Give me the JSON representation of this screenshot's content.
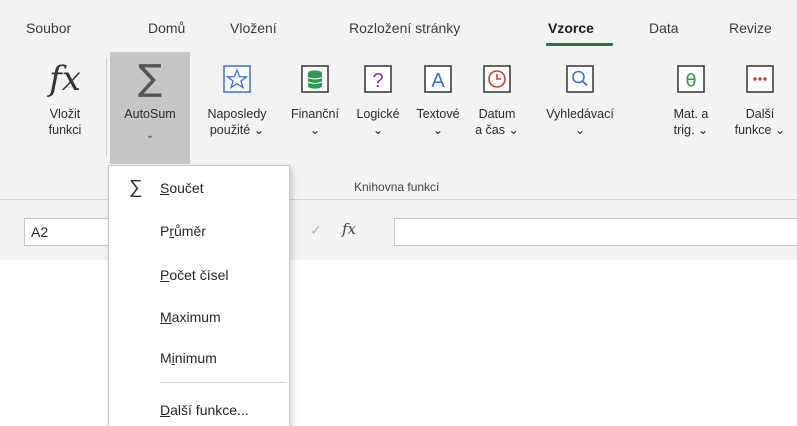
{
  "tabs": [
    {
      "label": "Soubor"
    },
    {
      "label": "Domů"
    },
    {
      "label": "Vložení"
    },
    {
      "label": "Rozložení stránky"
    },
    {
      "label": "Vzorce"
    },
    {
      "label": "Data"
    },
    {
      "label": "Revize"
    }
  ],
  "active_tab": "Vzorce",
  "ribbon": {
    "insert_function": {
      "line1": "Vložit",
      "line2": "funkci",
      "icon": "fx-icon"
    },
    "autosum": {
      "label": "AutoSum",
      "icon": "sigma-icon",
      "chevron": "⌄"
    },
    "buttons": [
      {
        "line1": "Naposledy",
        "line2": "použité ⌄",
        "icon": "star-icon"
      },
      {
        "line1": "Finanční",
        "line2": "⌄",
        "icon": "database-icon"
      },
      {
        "line1": "Logické",
        "line2": "⌄",
        "icon": "question-icon"
      },
      {
        "line1": "Textové",
        "line2": "⌄",
        "icon": "text-icon"
      },
      {
        "line1": "Datum",
        "line2": "a čas ⌄",
        "icon": "clock-icon"
      },
      {
        "line1": "Vyhledávací",
        "line2": "⌄",
        "icon": "search-icon"
      },
      {
        "line1": "Mat. a",
        "line2": "trig. ⌄",
        "icon": "theta-icon"
      },
      {
        "line1": "Další",
        "line2": "funkce ⌄",
        "icon": "more-icon"
      }
    ],
    "group_label": "Knihovna funkcí"
  },
  "formula_bar": {
    "name_box": "A2",
    "cancel_symbol": "✓",
    "fx_label": "fx",
    "formula": ""
  },
  "autosum_menu": {
    "items": [
      {
        "pre": "",
        "u": "S",
        "post": "oučet",
        "icon": "sigma-icon"
      },
      {
        "pre": "P",
        "u": "r",
        "post": "ůměr"
      },
      {
        "pre": "",
        "u": "P",
        "post": "očet čísel"
      },
      {
        "pre": "",
        "u": "M",
        "post": "aximum"
      },
      {
        "pre": "M",
        "u": "i",
        "post": "nimum"
      },
      {
        "pre": "",
        "u": "D",
        "post": "alší funkce..."
      }
    ]
  },
  "colors": {
    "accent": "#217346",
    "ribbon_bg": "#f3f3f3",
    "pressed": "#c6c6c6"
  }
}
